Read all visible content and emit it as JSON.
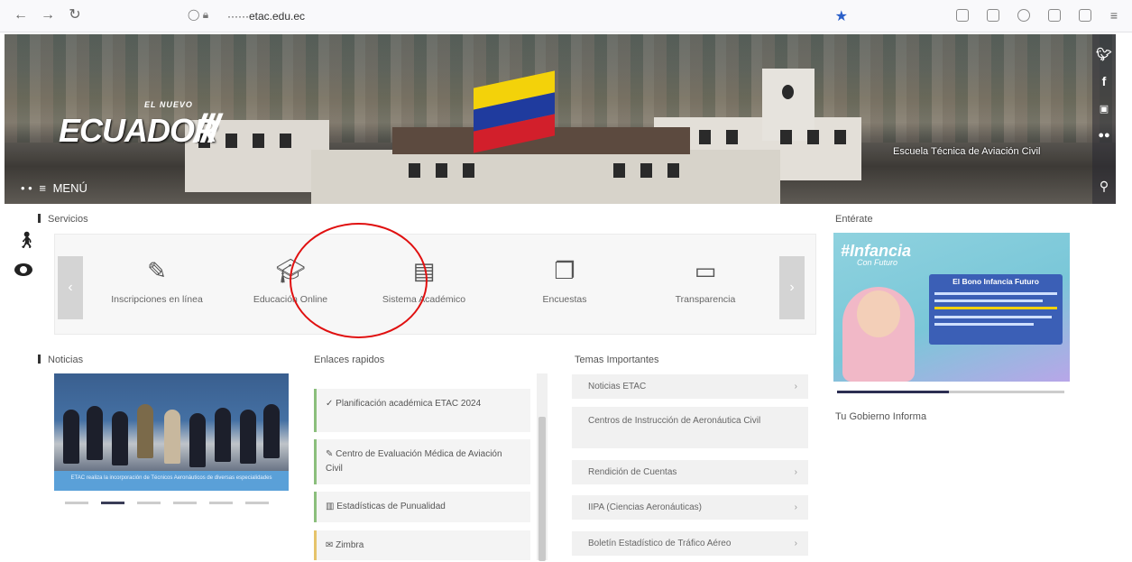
{
  "browser": {
    "url": "······etac.edu.ec",
    "nav": {
      "back": "←",
      "forward": "→",
      "reload": "↻"
    }
  },
  "hero": {
    "logo_small": "EL NUEVO",
    "logo_main": "ECUADOR",
    "logo_bars": "///",
    "menu_label": "MENÚ",
    "institution": "Escuela Técnica de Aviación Civil",
    "social": [
      "twitter-icon",
      "facebook-icon",
      "youtube-icon",
      "flickr-icon"
    ]
  },
  "servicios": {
    "title": "Servicios",
    "items": [
      {
        "label": "Inscripciones en línea",
        "icon": "edit-icon"
      },
      {
        "label": "Educación Online",
        "icon": "graduation-cap-icon"
      },
      {
        "label": "Sistema Académico",
        "icon": "document-icon"
      },
      {
        "label": "Encuestas",
        "icon": "copy-icon"
      },
      {
        "label": "Transparencia",
        "icon": "monitor-icon"
      }
    ]
  },
  "noticias": {
    "title": "Noticias",
    "caption": "ETAC realiza la incorporación de Técnicos Aeronáuticos de diversas especialidades",
    "slides": 6,
    "active_slide": 2
  },
  "enlaces": {
    "title": "Enlaces rapidos",
    "items": [
      {
        "icon": "check-icon",
        "label": "Planificación académica ETAC 2024"
      },
      {
        "icon": "edit-icon",
        "label": "Centro de Evaluación Médica de Aviación Civil"
      },
      {
        "icon": "bar-chart-icon",
        "label": "Estadísticas de Punualidad"
      },
      {
        "icon": "mail-icon",
        "label": "Zimbra"
      }
    ]
  },
  "temas": {
    "title": "Temas Importantes",
    "items": [
      "Noticias ETAC",
      "Centros de Instrucción de Aeronáutica Civil",
      "Rendición de Cuentas",
      "IIPA (Ciencias Aeronáuticas)",
      "Boletín Estadístico de Tráfico Aéreo"
    ]
  },
  "entérate": {
    "title": "Entérate",
    "banner_hashtag": "#Infancia",
    "banner_sub": "Con Futuro",
    "banner_panel_title": "El Bono Infancia Futuro"
  },
  "gobierno": {
    "title": "Tu Gobierno Informa"
  },
  "colors": {
    "accent_green": "#8bbf7c",
    "annotation_red": "#e01010",
    "banner_blue": "#3b5fb6"
  }
}
